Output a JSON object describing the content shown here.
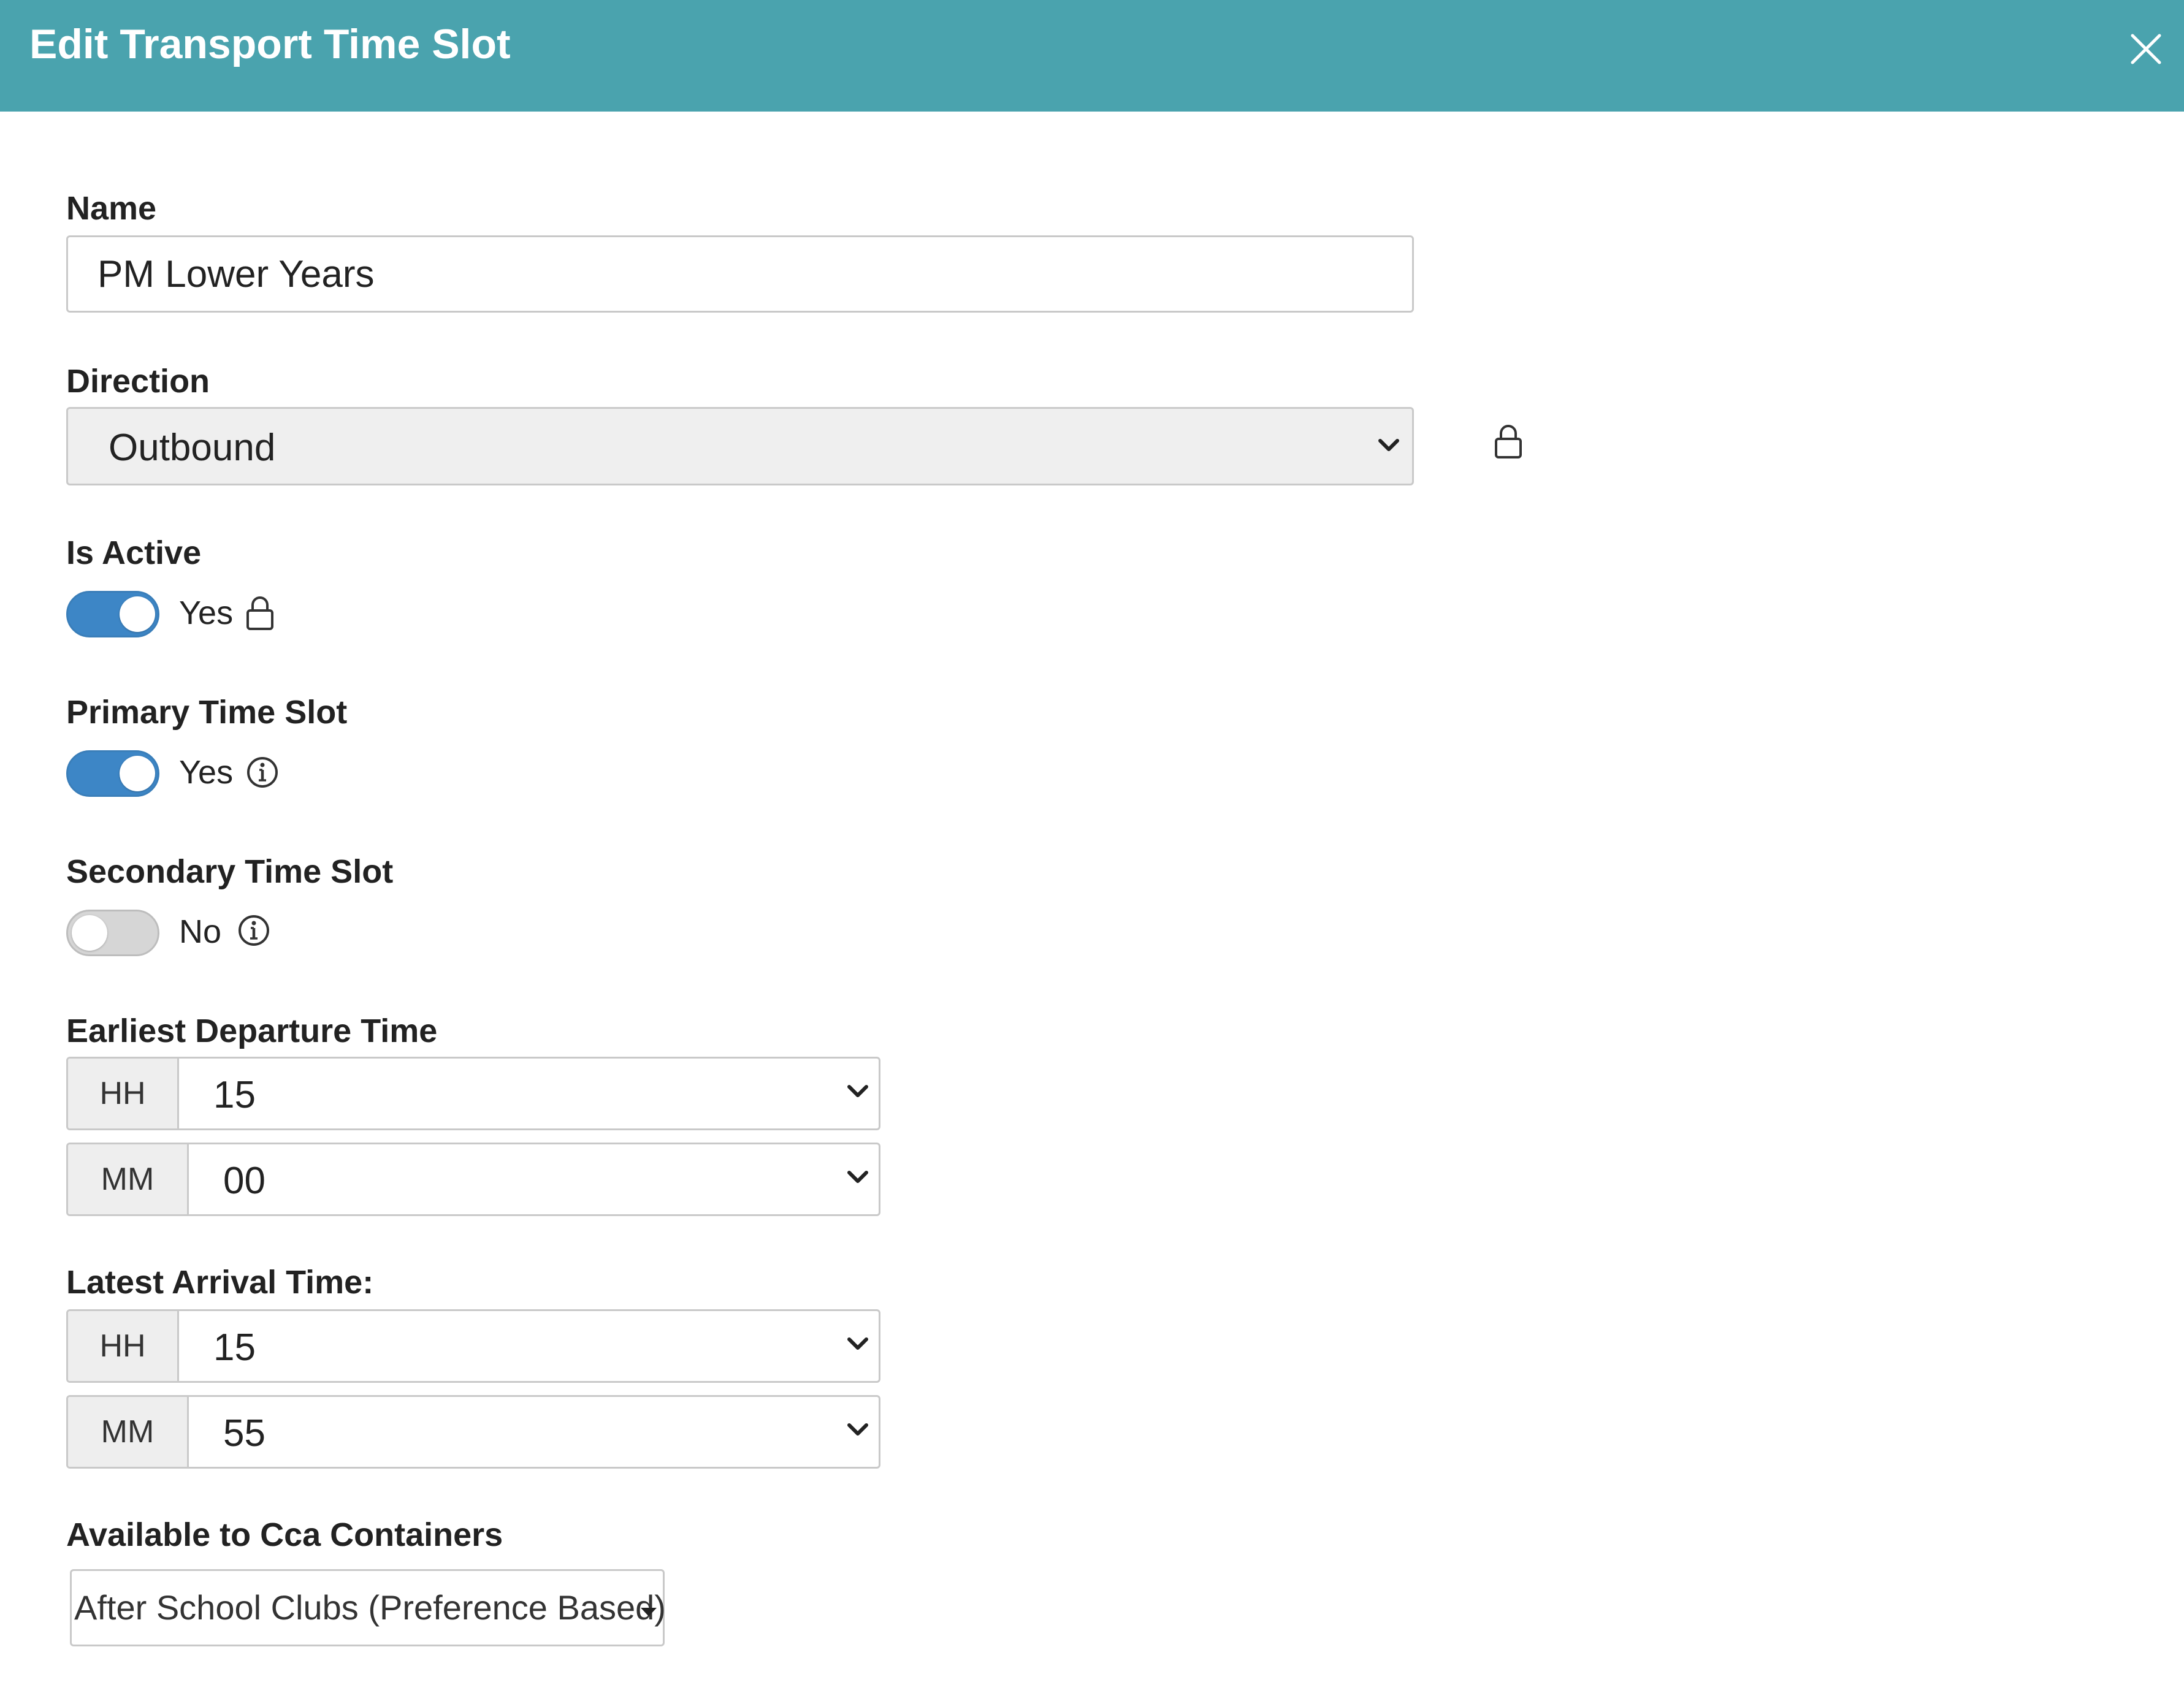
{
  "header": {
    "title": "Edit Transport Time Slot",
    "bg_color": "#4aa3ae",
    "close_icon": "close-icon"
  },
  "form": {
    "name": {
      "label": "Name",
      "value": "PM Lower Years"
    },
    "direction": {
      "label": "Direction",
      "value": "Outbound",
      "locked": true,
      "lock_icon": "lock-icon"
    },
    "is_active": {
      "label": "Is Active",
      "checked": true,
      "state_text": "Yes",
      "icon": "lock-icon"
    },
    "primary_time_slot": {
      "label": "Primary Time Slot",
      "checked": true,
      "state_text": "Yes",
      "icon": "info-icon"
    },
    "secondary_time_slot": {
      "label": "Secondary Time Slot",
      "checked": false,
      "state_text": "No",
      "icon": "info-icon"
    },
    "earliest_departure": {
      "label": "Earliest Departure Time",
      "hh_label": "HH",
      "hh_value": "15",
      "mm_label": "MM",
      "mm_value": "00"
    },
    "latest_arrival": {
      "label": "Latest Arrival Time:",
      "hh_label": "HH",
      "hh_value": "15",
      "mm_label": "MM",
      "mm_value": "55"
    },
    "cca_containers": {
      "label": "Available to Cca Containers",
      "value": "After School Clubs (Preference Based)"
    }
  },
  "colors": {
    "toggle_on": "#3d86c6",
    "toggle_off": "#d6d6d6"
  }
}
